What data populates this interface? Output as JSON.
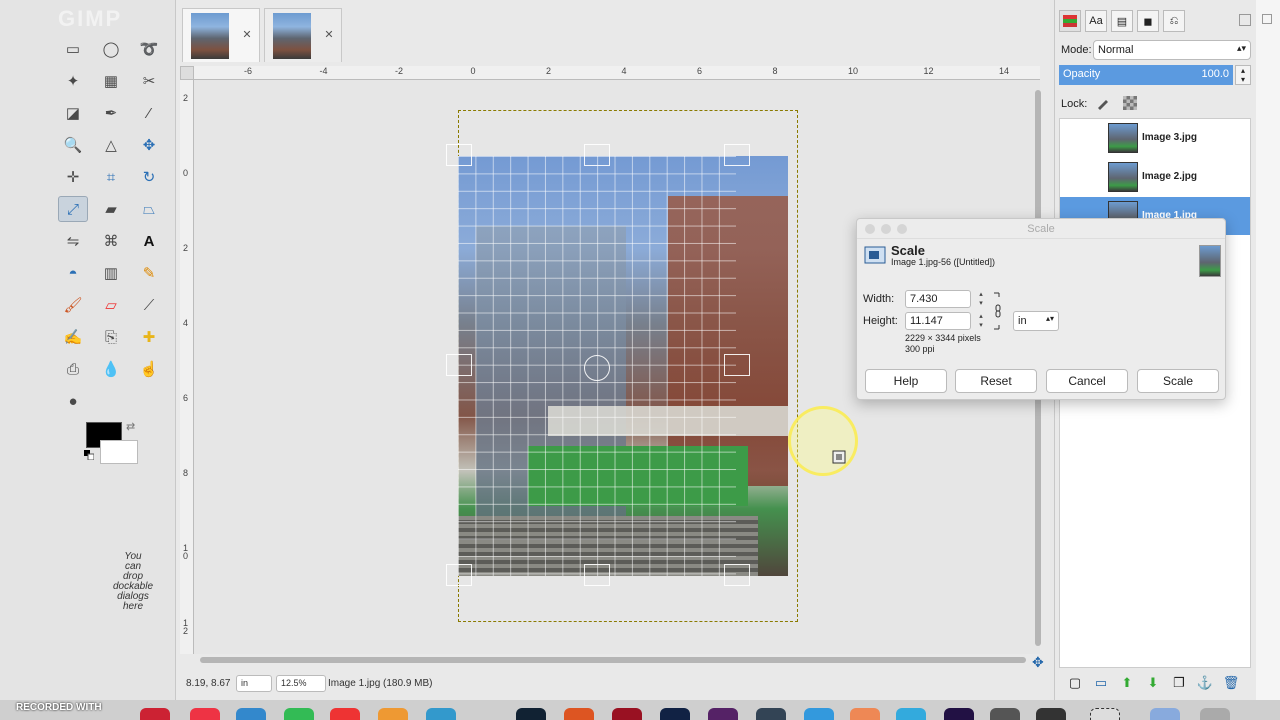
{
  "toolbox": {
    "tools": [
      "rect-select-icon",
      "ellipse-select-icon",
      "free-select-icon",
      "fuzzy-select-icon",
      "color-select-icon",
      "scissors-icon",
      "foreground-select-icon",
      "paths-icon",
      "color-picker-icon",
      "zoom-icon",
      "measure-icon",
      "move-icon",
      "align-icon",
      "crop-icon",
      "rotate-icon",
      "scale-icon",
      "shear-icon",
      "perspective-icon",
      "flip-icon",
      "cage-icon",
      "text-icon",
      "bucket-fill-icon",
      "gradient-icon",
      "pencil-icon",
      "paintbrush-icon",
      "eraser-icon",
      "airbrush-icon",
      "ink-icon",
      "clone-icon",
      "heal-icon",
      "perspective-clone-icon",
      "blur-icon",
      "smudge-icon",
      "dodge-burn-icon"
    ],
    "active_tool": "scale-icon",
    "foreground_color": "#000000",
    "background_color": "#ffffff",
    "drop_hint": "You\ncan\ndrop\ndockable\ndialogs\nhere"
  },
  "image_window": {
    "tabs": [
      {
        "name": "image-tab-1"
      },
      {
        "name": "image-tab-2"
      }
    ],
    "ruler_h_labels": [
      "-6",
      "-4",
      "-2",
      "0",
      "2",
      "4",
      "6",
      "8",
      "10",
      "12",
      "14"
    ],
    "ruler_v_labels": [
      "2",
      "0",
      "2",
      "4",
      "6",
      "8",
      "1 0",
      "1 2"
    ],
    "status": {
      "coords": "8.19, 8.67",
      "unit": "in",
      "zoom": "12.5%",
      "image_info": "Image 1.jpg (180.9 MB)"
    }
  },
  "dock": {
    "mode_label": "Mode:",
    "mode_value": "Normal",
    "opacity_label": "Opacity",
    "opacity_value": "100.0",
    "lock_label": "Lock:",
    "layers": [
      {
        "name": "Image 3.jpg",
        "selected": false
      },
      {
        "name": "Image 2.jpg",
        "selected": false
      },
      {
        "name": "Image 1.jpg",
        "selected": true
      }
    ]
  },
  "scale_dialog": {
    "window_title": "Scale",
    "heading": "Scale",
    "subtitle": "Image 1.jpg-56 ([Untitled])",
    "width_label": "Width:",
    "width_value": "7.430",
    "height_label": "Height:",
    "height_value": "11.147",
    "unit": "in",
    "pixels_info": "2229 × 3344 pixels",
    "resolution_info": "300 ppi",
    "buttons": {
      "help": "Help",
      "reset": "Reset",
      "cancel": "Cancel",
      "scale": "Scale"
    }
  },
  "taskbar": {
    "recorded_label": "RECORDED WITH"
  },
  "colors": {
    "accent": "#5b9ae0",
    "selection_border": "#8a7a00",
    "cursor_highlight": "#faeb50"
  }
}
